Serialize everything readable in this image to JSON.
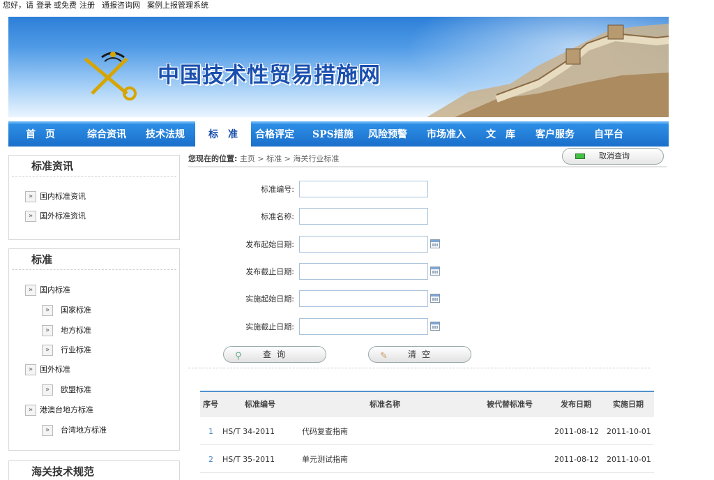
{
  "topbar": {
    "greeting": "您好，请",
    "login": "登录",
    "or": "或免费",
    "register": "注册",
    "link1": "通报咨询网",
    "link2": "案例上报管理系统"
  },
  "banner": {
    "title": "中国技术性贸易措施网"
  },
  "nav": {
    "items": [
      "首　页",
      "综合资讯",
      "技术法规",
      "标　准",
      "合格评定",
      "SPS措施",
      "风险预警",
      "市场准入",
      "文　库",
      "客户服务",
      "自平台"
    ],
    "active_index": 3
  },
  "sidebar": {
    "box1": {
      "title": "标准资讯",
      "items": [
        "国内标准资讯",
        "国外标准资讯"
      ]
    },
    "box2": {
      "title": "标准",
      "items": [
        {
          "label": "国内标准",
          "level": 0
        },
        {
          "label": "国家标准",
          "level": 1
        },
        {
          "label": "地方标准",
          "level": 1
        },
        {
          "label": "行业标准",
          "level": 1
        },
        {
          "label": "国外标准",
          "level": 0
        },
        {
          "label": "欧盟标准",
          "level": 1
        },
        {
          "label": "港澳台地方标准",
          "level": 0
        },
        {
          "label": "台湾地方标准",
          "level": 1
        }
      ]
    },
    "box3": {
      "title": "海关技术规范"
    }
  },
  "breadcrumb": {
    "prefix": "您现在的位置:",
    "home": "主页",
    "sep": ">",
    "level1": "标准",
    "level2": "海关行业标准"
  },
  "cancel_query": "取消查询",
  "form": {
    "fields": [
      {
        "label": "标准编号:",
        "value": "",
        "date": false
      },
      {
        "label": "标准名称:",
        "value": "",
        "date": false
      },
      {
        "label": "发布起始日期:",
        "value": "",
        "date": true
      },
      {
        "label": "发布截止日期:",
        "value": "",
        "date": true
      },
      {
        "label": "实施起始日期:",
        "value": "",
        "date": true
      },
      {
        "label": "实施截止日期:",
        "value": "",
        "date": true
      }
    ],
    "query_button": "查询",
    "clear_button": "清空"
  },
  "table": {
    "headers": [
      "序号",
      "标准编号",
      "标准名称",
      "被代替标准号",
      "发布日期",
      "实施日期"
    ],
    "rows": [
      [
        "1",
        "HS/T 34-2011",
        "代码复查指南",
        "",
        "2011-08-12",
        "2011-10-01"
      ],
      [
        "2",
        "HS/T 35-2011",
        "单元测试指南",
        "",
        "2011-08-12",
        "2011-10-01"
      ]
    ]
  }
}
